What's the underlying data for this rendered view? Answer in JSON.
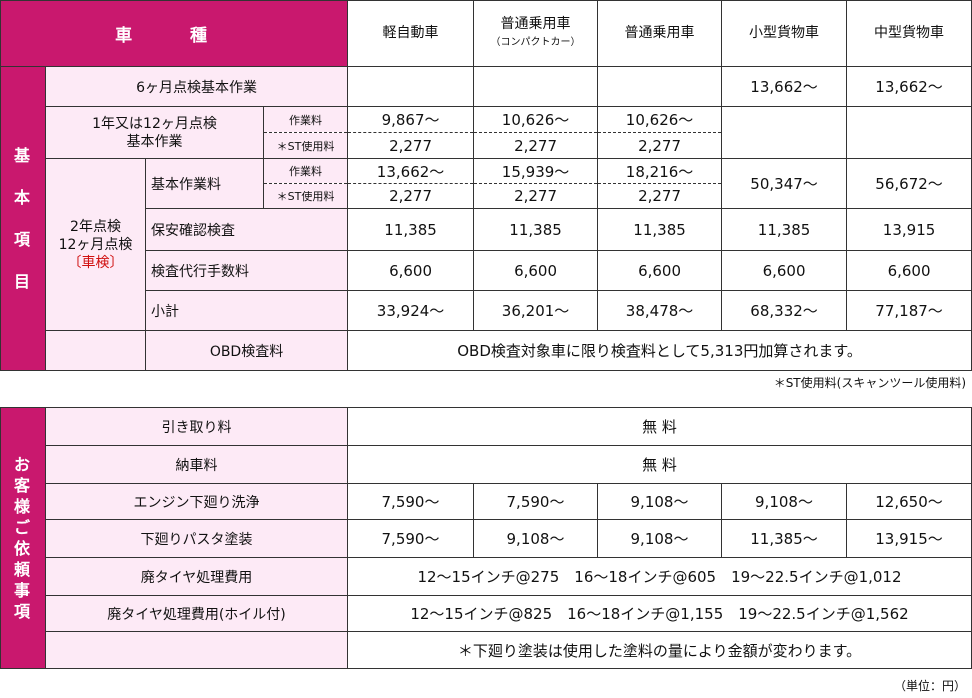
{
  "table1": {
    "header": {
      "kind_label": "車 種",
      "cols": [
        {
          "main": "軽自動車",
          "sub": ""
        },
        {
          "main": "普通乗用車",
          "sub": "（コンパクトカー）"
        },
        {
          "main": "普通乗用車",
          "sub": ""
        },
        {
          "main": "小型貨物車",
          "sub": ""
        },
        {
          "main": "中型貨物車",
          "sub": ""
        }
      ]
    },
    "side_label": "基本項目",
    "row_6m": {
      "label": "6ヶ月点検基本作業",
      "values": [
        "",
        "",
        "",
        "13,662〜",
        "13,662〜"
      ]
    },
    "row_12m": {
      "label": "1年又は12ヶ月点検 基本作業",
      "work_label": "作業料",
      "st_label": "＊ST使用料",
      "work": [
        "9,867〜",
        "10,626〜",
        "10,626〜"
      ],
      "st": [
        "2,277",
        "2,277",
        "2,277"
      ]
    },
    "shaken": {
      "label_line1": "2年点検",
      "label_line2": "12ヶ月点検",
      "label_line3": "〔車検〕",
      "basic": {
        "label": "基本作業料",
        "work_label": "作業料",
        "st_label": "＊ST使用料",
        "work": [
          "13,662〜",
          "15,939〜",
          "18,216〜"
        ],
        "st": [
          "2,277",
          "2,277",
          "2,277"
        ],
        "merged": [
          "50,347〜",
          "56,672〜"
        ]
      },
      "safety": {
        "label": "保安確認検査",
        "values": [
          "11,385",
          "11,385",
          "11,385",
          "11,385",
          "13,915"
        ]
      },
      "agency": {
        "label": "検査代行手数料",
        "values": [
          "6,600",
          "6,600",
          "6,600",
          "6,600",
          "6,600"
        ]
      },
      "subtotal": {
        "label": "小計",
        "values": [
          "33,924〜",
          "36,201〜",
          "38,478〜",
          "68,332〜",
          "77,187〜"
        ]
      }
    },
    "obd": {
      "label": "OBD検査料",
      "text": "OBD検査対象車に限り検査料として5,313円加算されます。"
    }
  },
  "note1": "＊ST使用料(スキャンツール使用料)",
  "table2": {
    "side_label": "お客様ご依頼事項",
    "pickup": {
      "label": "引き取り料",
      "text": "無 料"
    },
    "delivery": {
      "label": "納車料",
      "text": "無 料"
    },
    "engine_wash": {
      "label": "エンジン下廻り洗浄",
      "values": [
        "7,590〜",
        "7,590〜",
        "9,108〜",
        "9,108〜",
        "12,650〜"
      ]
    },
    "underbody": {
      "label": "下廻りパスタ塗装",
      "values": [
        "7,590〜",
        "9,108〜",
        "9,108〜",
        "11,385〜",
        "13,915〜"
      ]
    },
    "tire": {
      "label": "廃タイヤ処理費用",
      "text": "12〜15インチ@275　16〜18インチ@605　19〜22.5インチ@1,012"
    },
    "tire_wheel": {
      "label": "廃タイヤ処理費用(ホイル付)",
      "text": "12〜15インチ@825　16〜18インチ@1,155　19〜22.5インチ@1,562"
    },
    "paint_note": "＊下廻り塗装は使用した塗料の量により金額が変わります。"
  },
  "note2": "（単位：円）",
  "colors": {
    "header_bg": "#c9186e",
    "label_bg": "#fdeaf6",
    "red_text": "#d01010"
  }
}
